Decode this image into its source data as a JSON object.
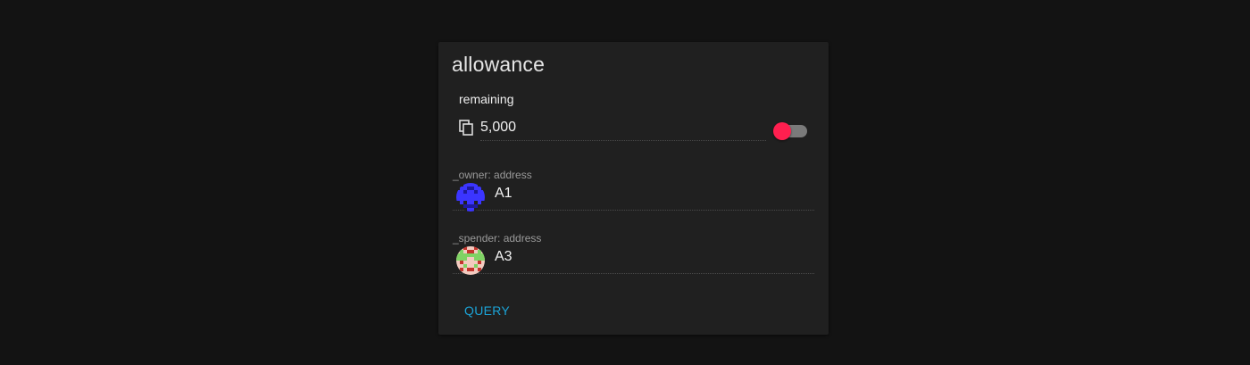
{
  "card": {
    "title": "allowance",
    "result": {
      "label": "remaining",
      "value": "5,000",
      "copy_icon": "copy-icon",
      "toggle_on": false
    },
    "inputs": [
      {
        "label": "_owner: address",
        "value": "A1",
        "avatar": "identicon-blue"
      },
      {
        "label": "_spender: address",
        "value": "A3",
        "avatar": "identicon-green-red"
      }
    ],
    "query_label": "QUERY"
  },
  "colors": {
    "background": "#131313",
    "card": "#202020",
    "accent": "#1ba4d8",
    "toggle_thumb": "#ff1f4f"
  }
}
